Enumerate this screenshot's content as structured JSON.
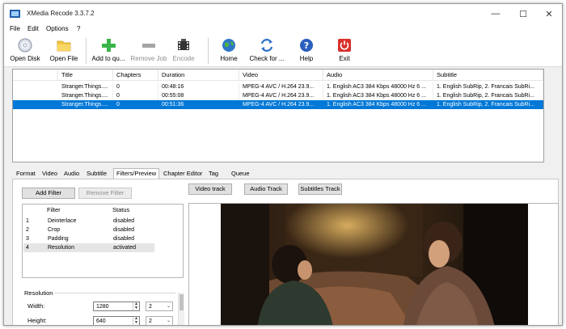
{
  "window": {
    "title": "XMedia Recode 3.3.7.2",
    "controls": {
      "minimize": "—",
      "maximize": "☐",
      "close": "✕"
    }
  },
  "menu": [
    "File",
    "Edit",
    "Options",
    "?"
  ],
  "toolbar": {
    "items": [
      {
        "label": "Open Disk",
        "icon": "disc-icon",
        "enabled": true
      },
      {
        "label": "Open File",
        "icon": "folder-icon",
        "enabled": true
      },
      {
        "label": "Add to qu...",
        "icon": "plus-icon",
        "enabled": true
      },
      {
        "label": "Remove Job",
        "icon": "minus-icon",
        "enabled": false
      },
      {
        "label": "Encode",
        "icon": "film-icon",
        "enabled": false
      },
      {
        "label": "Home",
        "icon": "globe-icon",
        "enabled": true
      },
      {
        "label": "Check for ...",
        "icon": "refresh-icon",
        "enabled": true
      },
      {
        "label": "Help",
        "icon": "help-icon",
        "enabled": true
      },
      {
        "label": "Exit",
        "icon": "power-icon",
        "enabled": true
      }
    ]
  },
  "file_list": {
    "columns": [
      "Title",
      "Chapters",
      "Duration",
      "Video",
      "Audio",
      "Subtitle"
    ],
    "rows": [
      {
        "title": "Stranger.Things....",
        "chapters": "0",
        "duration": "00:48:16",
        "video": "MPEG-4 AVC / H.264 23.9...",
        "audio": "1. English AC3 384 Kbps 48000 Hz 6 ...",
        "subtitle": "1. English SubRip, 2. Francais SubRi...",
        "selected": false
      },
      {
        "title": "Stranger.Things....",
        "chapters": "0",
        "duration": "00:55:08",
        "video": "MPEG-4 AVC / H.264 23.9...",
        "audio": "1. English AC3 384 Kbps 48000 Hz 6 ...",
        "subtitle": "1. English SubRip, 2. Francais SubRi...",
        "selected": false
      },
      {
        "title": "Stranger.Things....",
        "chapters": "0",
        "duration": "00:51:36",
        "video": "MPEG-4 AVC / H.264 23.9...",
        "audio": "1. English AC3 384 Kbps 48000 Hz 6 ...",
        "subtitle": "1. English SubRip, 2. Francais SubRi...",
        "selected": true
      }
    ]
  },
  "tabs": [
    "Format",
    "Video",
    "Audio",
    "Subtitle",
    "Filters/Preview",
    "Chapter Editor",
    "Tag",
    "Queue"
  ],
  "active_tab": "Filters/Preview",
  "panel": {
    "add_filter": "Add Filter",
    "remove_filter": "Remove Filter",
    "video_track": "Video track",
    "audio_track": "Audio Track",
    "subtitles_track": "Subtitles Track",
    "filters": {
      "columns": [
        "Filter",
        "Status"
      ],
      "rows": [
        {
          "num": "1",
          "name": "Deinterlace",
          "status": "disabled"
        },
        {
          "num": "2",
          "name": "Crop",
          "status": "disabled"
        },
        {
          "num": "3",
          "name": "Padding",
          "status": "disabled"
        },
        {
          "num": "4",
          "name": "Resolution",
          "status": "activated"
        }
      ]
    },
    "resolution": {
      "group_label": "Resolution",
      "width_label": "Width:",
      "width_value": "1280",
      "width_factor": "2",
      "height_label": "Height:",
      "height_value": "640",
      "height_factor": "2"
    }
  },
  "colors": {
    "selection": "#0078d7",
    "window_bg": "#f0f0f0",
    "exit_red": "#d9302c",
    "plus_green": "#3ab54a"
  }
}
